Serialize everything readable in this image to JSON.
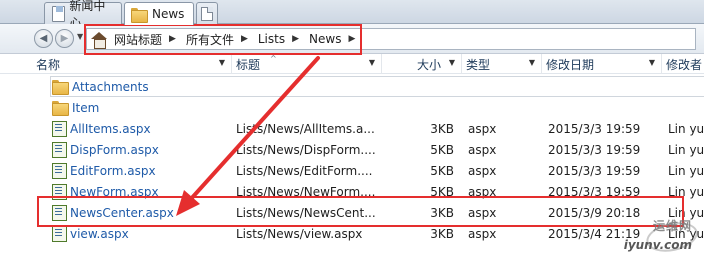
{
  "tabs": [
    {
      "label": "新闻中心"
    },
    {
      "label": "News"
    }
  ],
  "breadcrumb": [
    "网站标题",
    "所有文件",
    "Lists",
    "News"
  ],
  "columns": {
    "name": "名称",
    "title": "标题",
    "size": "大小",
    "type": "类型",
    "date": "修改日期",
    "modified_by": "修改者"
  },
  "folders": [
    {
      "name": "Attachments"
    },
    {
      "name": "Item"
    }
  ],
  "files": [
    {
      "name": "AllItems.aspx",
      "title": "Lists/News/AllItems.a...",
      "size": "3KB",
      "type": "aspx",
      "date": "2015/3/3 19:59",
      "modified_by": "Lin yu"
    },
    {
      "name": "DispForm.aspx",
      "title": "Lists/News/DispForm....",
      "size": "5KB",
      "type": "aspx",
      "date": "2015/3/3 19:59",
      "modified_by": "Lin yu"
    },
    {
      "name": "EditForm.aspx",
      "title": "Lists/News/EditForm....",
      "size": "5KB",
      "type": "aspx",
      "date": "2015/3/3 19:59",
      "modified_by": "Lin yu"
    },
    {
      "name": "NewForm.aspx",
      "title": "Lists/News/NewForm....",
      "size": "5KB",
      "type": "aspx",
      "date": "2015/3/3 19:59",
      "modified_by": "Lin yu"
    },
    {
      "name": "NewsCenter.aspx",
      "title": "Lists/News/NewsCent...",
      "size": "3KB",
      "type": "aspx",
      "date": "2015/3/9 20:18",
      "modified_by": "Lin yu"
    },
    {
      "name": "view.aspx",
      "title": "Lists/News/view.aspx",
      "size": "3KB",
      "type": "aspx",
      "date": "2015/3/4 21:19",
      "modified_by": "Lin yu"
    }
  ],
  "watermark": {
    "line1": "运维网",
    "line2": "iyunv.com"
  },
  "colors": {
    "annotation": "#e52e2e",
    "link": "#1e5aa8"
  }
}
